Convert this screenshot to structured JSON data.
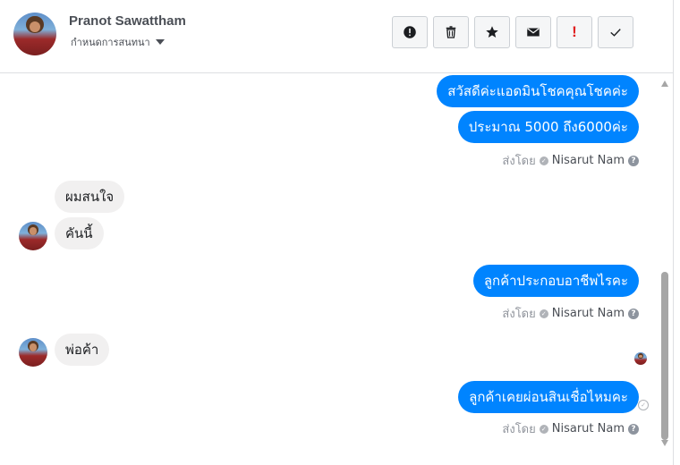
{
  "header": {
    "name": "Pranot Sawattham",
    "assign_label": "กำหนดการสนทนา",
    "actions": [
      {
        "icon": "alert-circle-icon"
      },
      {
        "icon": "trash-icon"
      },
      {
        "icon": "star-icon"
      },
      {
        "icon": "envelope-icon"
      },
      {
        "icon": "exclamation-icon",
        "label": "!"
      },
      {
        "icon": "checkmark-icon"
      }
    ]
  },
  "messages": {
    "m1": "สวัสดีค่ะแอดมินโชคคุณโชคค่ะ",
    "m2": "ประมาณ 5000 ถึง6000ค่ะ",
    "m3": "ผมสนใจ",
    "m4": "คันนี้",
    "m5": "ลูกค้าประกอบอาชีพไรคะ",
    "m6": "พ่อค้า",
    "m7": "ลูกค้าเคยผ่อนสินเชื่อไหมคะ"
  },
  "sent_by": {
    "label": "ส่งโดย",
    "name": "Nisarut Nam",
    "help": "?"
  },
  "colors": {
    "outgoing_bubble": "#0084ff",
    "incoming_bubble": "#f1f0f0",
    "alert": "#e02020"
  }
}
